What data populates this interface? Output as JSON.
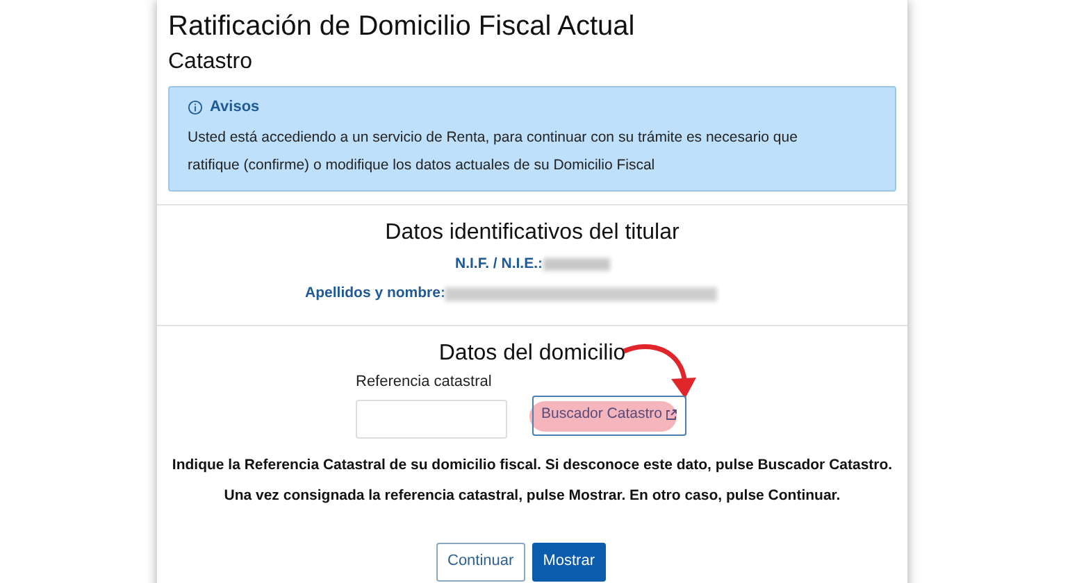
{
  "title": "Ratificación de Domicilio Fiscal Actual",
  "subtitle": "Catastro",
  "notice": {
    "heading": "Avisos",
    "text": "Usted está accediendo a un servicio de Renta, para continuar con su trámite es necesario que ratifique (confirme) o modifique los datos actuales de su Domicilio Fiscal"
  },
  "holder": {
    "heading": "Datos identificativos del titular",
    "fields": [
      {
        "label": "N.I.F. / N.I.E.:",
        "redacted": true
      },
      {
        "label": "Apellidos y nombre:",
        "redacted": true
      }
    ]
  },
  "address": {
    "heading": "Datos del domicilio",
    "field_label": "Referencia catastral",
    "search_button": {
      "label": "Buscador Catastro",
      "highlighted": true
    },
    "instructions": [
      "Indique la Referencia Catastral de su domicilio fiscal. Si desconoce este dato, pulse Buscador Catastro.",
      "Una vez consignada la referencia catastral, pulse Mostrar. En otro caso, pulse Continuar."
    ]
  },
  "buttons": [
    {
      "label": "Continuar",
      "kind": "secondary"
    },
    {
      "label": "Mostrar",
      "kind": "primary"
    }
  ]
}
